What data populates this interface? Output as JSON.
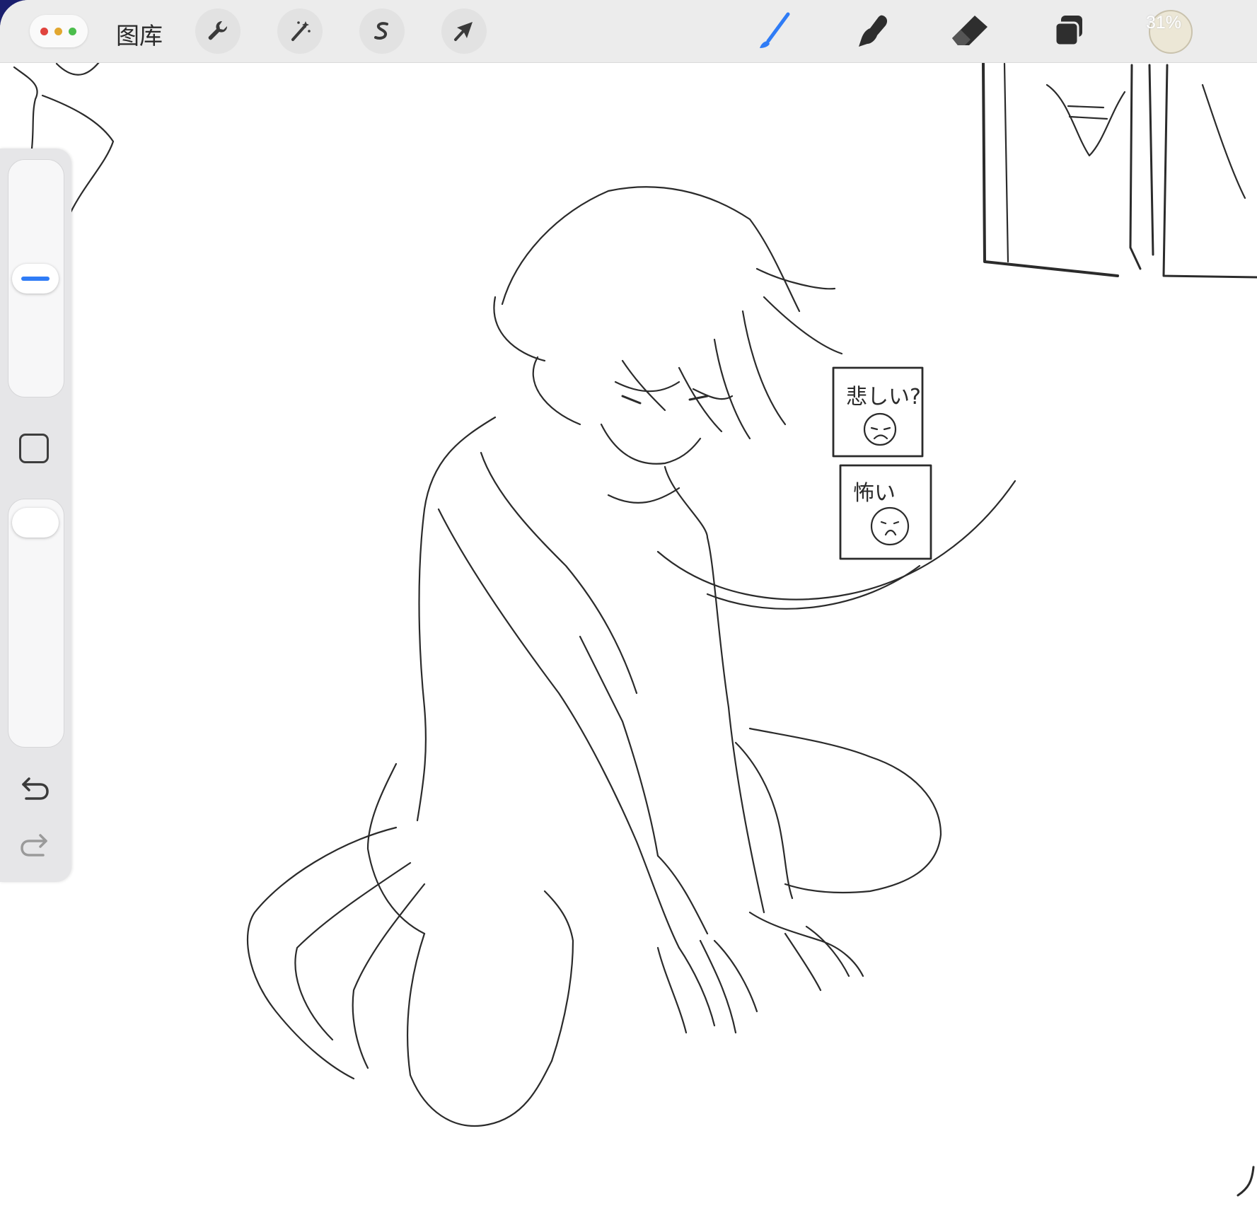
{
  "toolbar": {
    "gallery_label": "图库",
    "left_tools": [
      {
        "name": "actions",
        "icon": "wrench-icon"
      },
      {
        "name": "adjustments",
        "icon": "magic-wand-icon"
      },
      {
        "name": "selection",
        "icon": "selection-s-icon"
      },
      {
        "name": "transform",
        "icon": "arrow-cursor-icon"
      }
    ],
    "right_tools": [
      {
        "name": "brush",
        "icon": "brush-icon",
        "active": true
      },
      {
        "name": "smudge",
        "icon": "smudge-finger-icon"
      },
      {
        "name": "eraser",
        "icon": "eraser-icon"
      },
      {
        "name": "layers",
        "icon": "layers-icon"
      }
    ],
    "battery_text": "31%",
    "accent_color": "#2f7cf6"
  },
  "sidebar": {
    "brush_size_slider": {
      "label": "brush-size"
    },
    "opacity_slider": {
      "label": "opacity"
    },
    "modify_button": {
      "icon": "square-icon"
    },
    "undo": {
      "icon": "undo-icon"
    },
    "redo": {
      "icon": "redo-icon"
    }
  },
  "canvas": {
    "speech_card_1_text": "悲しい?",
    "speech_card_2_text": "怖い"
  }
}
